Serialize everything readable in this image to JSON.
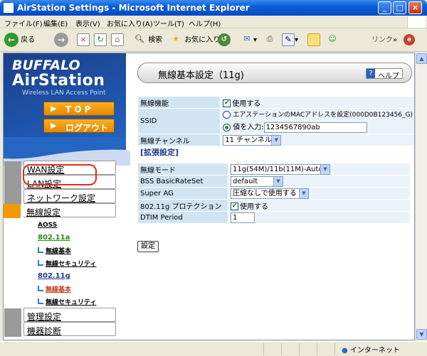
{
  "window": {
    "title": "AirStation Settings - Microsoft Internet Explorer"
  },
  "menubar": [
    "ファイル(F)",
    "編集(E)",
    "表示(V)",
    "お気に入り(A)",
    "ツール(T)",
    "ヘルプ(H)"
  ],
  "toolbar": {
    "back": "戻る",
    "search": "検索",
    "favorites": "お気に入り",
    "links": "リンク"
  },
  "status": {
    "zone": "インターネット"
  },
  "brand": {
    "buffalo": "BUFFALO",
    "airstation": "AirStation",
    "tagline": "Wireless LAN Access Point"
  },
  "nav_buttons": {
    "top": "T O P",
    "logout": "ログアウト"
  },
  "menu": {
    "wan": "WAN設定",
    "lan": "LAN設定",
    "network": "ネットワーク設定",
    "wireless": "無線設定",
    "aoss": "AOSS",
    "g80211a": "802.11a",
    "a_basic": "無線基本",
    "a_security": "無線セキュリティ",
    "g80211g": "802.11g",
    "g_basic": "無線基本",
    "g_security": "無線セキュリティ",
    "admin": "管理設定",
    "diag": "機器診断"
  },
  "page": {
    "title": "無線基本設定（11g)",
    "help": "ヘルプ",
    "section": "[拡張設定]",
    "set_button": "設定"
  },
  "form": {
    "wireless_func": {
      "label": "無線機能",
      "checkbox": "使用する",
      "checked": true
    },
    "ssid": {
      "label": "SSID",
      "opt1": "エアステーションのMACアドレスを設定(000D0B123456_G)",
      "opt2": "値を入力:",
      "value": "1234567890ab"
    },
    "channel": {
      "label": "無線チャンネル",
      "value": "11 チャンネル"
    },
    "mode": {
      "label": "無線モード",
      "value": "11g(54M)/11b(11M)-Auto"
    },
    "bss": {
      "label": "BSS BasicRateSet",
      "value": "default"
    },
    "superag": {
      "label": "Super AG",
      "value": "圧縮なしで使用する"
    },
    "protection": {
      "label": "802.11g プロテクション",
      "checkbox": "使用する",
      "checked": true
    },
    "dtim": {
      "label": "DTIM Period",
      "value": "1"
    }
  },
  "colors": {
    "accent_orange": "#f39800",
    "brand_blue": "#1e55ae",
    "label_bg": "#d1e4f1",
    "value_bg": "#eaf3f9",
    "highlight_red": "#e22b1c"
  }
}
